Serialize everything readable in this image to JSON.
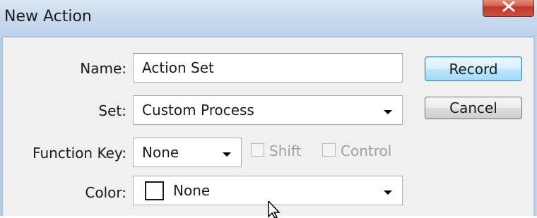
{
  "window": {
    "title": "New Action"
  },
  "form": {
    "name_label": "Name:",
    "name_value": "Action Set",
    "set_label": "Set:",
    "set_value": "Custom Process",
    "function_key_label": "Function Key:",
    "function_key_value": "None",
    "shift_label": "Shift",
    "control_label": "Control",
    "color_label": "Color:",
    "color_value": "None"
  },
  "buttons": {
    "record_label": "Record",
    "cancel_label": "Cancel"
  },
  "icons": {
    "close": "close-icon",
    "dropdown": "chevron-down-icon",
    "swatch": "color-swatch-icon"
  },
  "colors": {
    "titlebar": "#c9dbee",
    "close_button": "#c9503f",
    "default_button": "#bee6fd",
    "disabled_text": "#a0a0a0"
  }
}
